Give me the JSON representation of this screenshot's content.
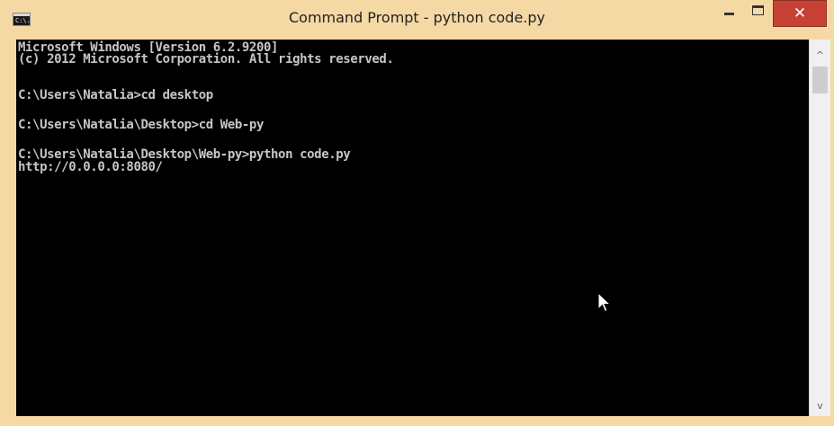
{
  "window": {
    "title": "Command Prompt - python  code.py",
    "icon": "cmd-icon",
    "icon_text": "C:\\.",
    "controls": {
      "minimize_icon": "minimize-icon",
      "maximize_icon": "maximize-icon",
      "close_label": "✕"
    }
  },
  "console": {
    "lines": [
      "Microsoft Windows [Version 6.2.9200]",
      "(c) 2012 Microsoft Corporation. All rights reserved.",
      "",
      "C:\\Users\\Natalia>cd desktop",
      "",
      "C:\\Users\\Natalia\\Desktop>cd Web-py",
      "",
      "C:\\Users\\Natalia\\Desktop\\Web-py>python code.py",
      "http://0.0.0.0:8080/"
    ]
  },
  "scrollbar": {
    "up_arrow": "^",
    "down_arrow": "v"
  },
  "colors": {
    "title_bar": "#f5d9a5",
    "console_background": "#000000",
    "console_text": "#c6c6c6",
    "close_button": "#c74235"
  }
}
